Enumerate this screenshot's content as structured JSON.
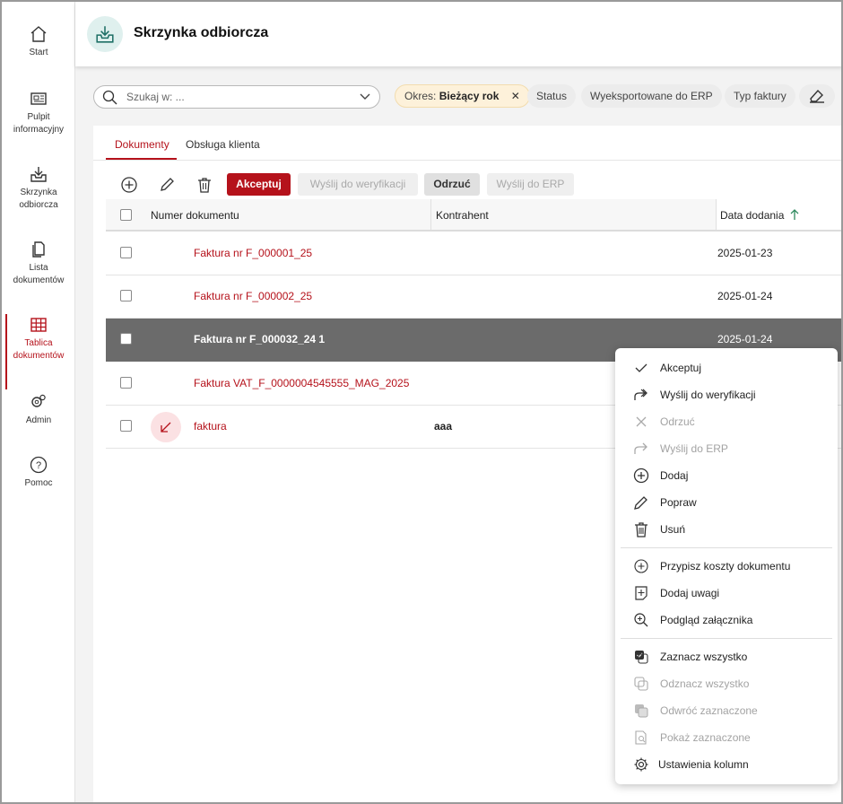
{
  "sidebar": {
    "items": [
      {
        "label": "Start"
      },
      {
        "label": "Pulpit informacyjny"
      },
      {
        "label": "Skrzynka odbiorcza"
      },
      {
        "label": "Lista dokumentów"
      },
      {
        "label": "Tablica dokumentów",
        "active": true
      },
      {
        "label": "Admin"
      },
      {
        "label": "Pomoc"
      }
    ]
  },
  "header": {
    "title": "Skrzynka odbiorcza"
  },
  "search": {
    "placeholder": "Szukaj w: ..."
  },
  "filters": {
    "period_label": "Okres:",
    "period_value": "Bieżący rok",
    "status": "Status",
    "exported": "Wyeksportowane do ERP",
    "invoice_type": "Typ faktury"
  },
  "tabs": [
    {
      "label": "Dokumenty"
    },
    {
      "label": "Obsługa klienta"
    }
  ],
  "toolbar": {
    "accept": "Akceptuj",
    "send_verification": "Wyślij do weryfikacji",
    "reject": "Odrzuć",
    "send_erp": "Wyślij do ERP"
  },
  "table": {
    "columns": [
      "Numer dokumentu",
      "Kontrahent",
      "Data dodania"
    ],
    "sort_column": "Data dodania",
    "rows": [
      {
        "number": "Faktura nr F_000001_25",
        "contractor": "",
        "date": "2025-01-23"
      },
      {
        "number": "Faktura nr F_000002_25",
        "contractor": "",
        "date": "2025-01-24"
      },
      {
        "number": "Faktura nr F_000032_24 1",
        "contractor": "",
        "date": "2025-01-24",
        "selected": true
      },
      {
        "number": "Faktura VAT_F_0000004545555_MAG_2025",
        "contractor": "",
        "date": ""
      },
      {
        "number": "faktura",
        "contractor": "aaa",
        "date": ""
      }
    ]
  },
  "context_menu": {
    "items": [
      {
        "label": "Akceptuj",
        "icon": "check-icon"
      },
      {
        "label": "Wyślij do weryfikacji",
        "icon": "forward-icon"
      },
      {
        "label": "Odrzuć",
        "icon": "close-icon",
        "disabled": true
      },
      {
        "label": "Wyślij do ERP",
        "icon": "share-icon",
        "disabled": true
      },
      {
        "label": "Dodaj",
        "icon": "plus-circle-icon"
      },
      {
        "label": "Popraw",
        "icon": "pencil-icon"
      },
      {
        "label": "Usuń",
        "icon": "trash-icon"
      },
      {
        "label": "Przypisz koszty dokumentu",
        "icon": "plus-circle-icon"
      },
      {
        "label": "Dodaj uwagi",
        "icon": "note-add-icon"
      },
      {
        "label": "Podgląd załącznika",
        "icon": "zoom-icon"
      },
      {
        "label": "Zaznacz wszystko",
        "icon": "select-all-icon"
      },
      {
        "label": "Odznacz wszystko",
        "icon": "deselect-all-icon",
        "disabled": true
      },
      {
        "label": "Odwróć zaznaczone",
        "icon": "invert-selection-icon",
        "disabled": true
      },
      {
        "label": "Pokaż zaznaczone",
        "icon": "show-selected-icon",
        "disabled": true
      },
      {
        "label": "Ustawienia kolumn",
        "icon": "gear-icon"
      }
    ]
  },
  "colors": {
    "accent": "#b5121b",
    "selected_row": "#6b6b6b",
    "period_chip": "#fdf1da"
  }
}
